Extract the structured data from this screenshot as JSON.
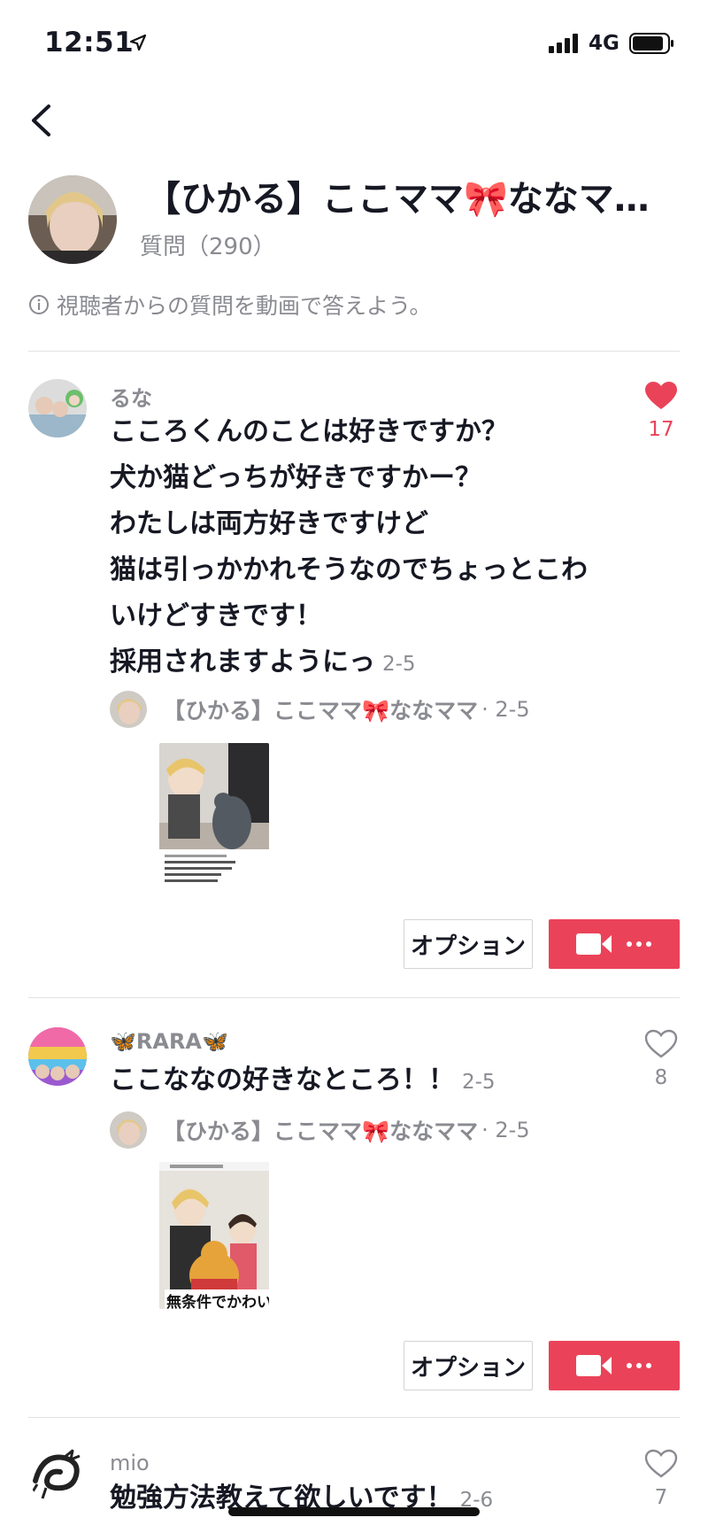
{
  "status_bar": {
    "time": "12:51",
    "network": "4G"
  },
  "header": {
    "title": "【ひかる】ここママ🎀ななマ…",
    "question_count": "質問（290）",
    "info_text": "視聴者からの質問を動画で答えよう。"
  },
  "questions": [
    {
      "username": "るな",
      "lines": [
        "こころくんのことは好きですか？",
        "犬か猫どっちが好きですかー？",
        "わたしは両方好きですけど",
        "猫は引っかかれそうなのでちょっとこわ",
        "いけどすきです！",
        "採用されますようにっ"
      ],
      "date": "2-5",
      "likes": "17",
      "liked": true,
      "answer": {
        "name": "【ひかる】ここママ🎀ななママ",
        "date": "· 2-5"
      },
      "option_label": "オプション"
    },
    {
      "username": "🦋RARA🦋",
      "lines": [
        "ここななの好きなところ！！"
      ],
      "date": "2-5",
      "likes": "8",
      "liked": false,
      "answer": {
        "name": "【ひかる】ここママ🎀ななママ",
        "date": "· 2-5"
      },
      "thumb_caption": "無条件でかわいい",
      "option_label": "オプション"
    },
    {
      "username": "mio",
      "lines": [
        "勉強方法教えて欲しいです！"
      ],
      "date": "2-6",
      "likes": "7",
      "liked": false
    }
  ],
  "colors": {
    "accent": "#ea4359",
    "muted": "#8a8b91",
    "text": "#161823"
  }
}
